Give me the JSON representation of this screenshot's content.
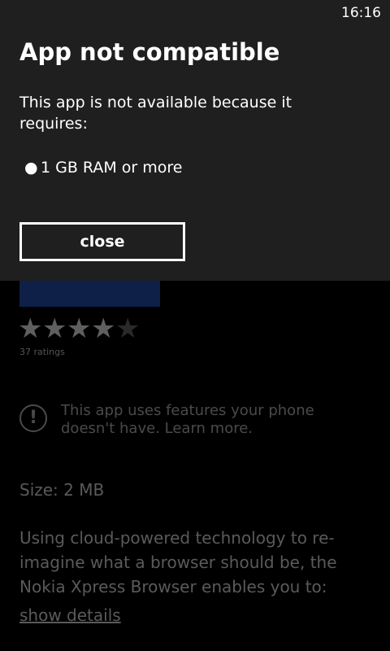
{
  "status_bar": {
    "time": "16:16"
  },
  "dialog": {
    "title": "App not compatible",
    "message": "This app is not available because it requires:",
    "requirements": [
      "1 GB RAM or more"
    ],
    "bullet": "●",
    "close_label": "close"
  },
  "app_page": {
    "rating": {
      "stars_filled": 4,
      "stars_total": 5,
      "star_glyph": "★",
      "count_label": "37 ratings"
    },
    "notice": {
      "icon": "exclamation-circle-icon",
      "icon_glyph": "!",
      "text": "This app uses features your phone doesn't have. Learn more."
    },
    "size_label": "Size: 2 MB",
    "description": "Using cloud-powered technology to re-imagine what a browser should be, the Nokia Xpress Browser enables you to:",
    "show_details_label": "show details"
  },
  "colors": {
    "dialog_background": "#1f1f1f",
    "page_background": "#000000",
    "app_tile": "#0e2047"
  }
}
